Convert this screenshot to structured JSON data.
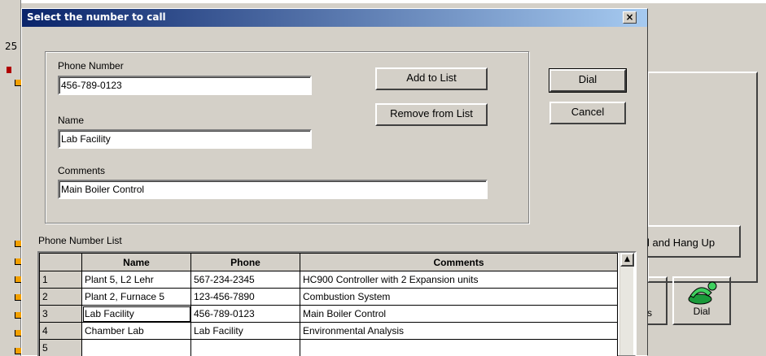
{
  "background": {
    "side_label": "25",
    "hangup_button": "l and Hang Up",
    "ics_label": "cs",
    "dial_button": "Dial"
  },
  "dialog": {
    "title": "Select the number to call",
    "close_glyph": "×",
    "phone_number": {
      "label": "Phone Number",
      "value": "456-789-0123"
    },
    "name": {
      "label": "Name",
      "value": "Lab Facility"
    },
    "comments": {
      "label": "Comments",
      "value": "Main Boiler Control"
    },
    "add_to_list": "Add to List",
    "remove_from_list": "Remove from List",
    "dial": "Dial",
    "cancel": "Cancel",
    "list_label": "Phone Number List",
    "table": {
      "headers": [
        "Name",
        "Phone",
        "Comments"
      ],
      "rows": [
        {
          "num": "1",
          "name": "Plant 5, L2 Lehr",
          "phone": "567-234-2345",
          "comments": "HC900 Controller with 2 Expansion units"
        },
        {
          "num": "2",
          "name": "Plant 2, Furnace 5",
          "phone": "123-456-7890",
          "comments": "Combustion System"
        },
        {
          "num": "3",
          "name": "Lab Facility",
          "phone": "456-789-0123",
          "comments": "Main Boiler Control"
        },
        {
          "num": "4",
          "name": "Chamber Lab",
          "phone": "Lab Facility",
          "comments": "Environmental Analysis"
        },
        {
          "num": "5",
          "name": "",
          "phone": "",
          "comments": ""
        }
      ]
    }
  }
}
